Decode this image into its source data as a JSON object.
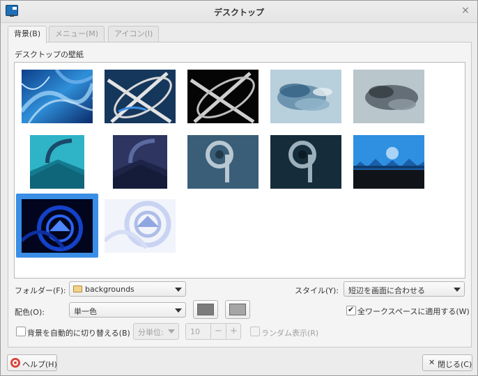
{
  "window": {
    "title": "デスクトップ",
    "close": "×"
  },
  "tabs": [
    {
      "label": "背景(B)",
      "active": true
    },
    {
      "label": "メニュー(M)",
      "active": false
    },
    {
      "label": "アイコン(I)",
      "active": false
    }
  ],
  "wallpaper_section": {
    "label": "デスクトップの壁紙",
    "selected_index": 10
  },
  "folder": {
    "label": "フォルダー(F):",
    "value": "backgrounds",
    "icon": "folder-icon"
  },
  "style": {
    "label": "スタイル(Y):",
    "value": "短辺を画面に合わせる"
  },
  "color": {
    "label": "配色(O):",
    "value": "単一色",
    "swatch1": "#7c7c7c",
    "swatch2": "#a6a6a6"
  },
  "apply_all": {
    "label": "全ワークスペースに適用する(W)",
    "checked": true
  },
  "auto_change": {
    "label": "背景を自動的に切り替える(B)",
    "checked": false,
    "unit": "分単位:",
    "interval": "10",
    "minus": "−",
    "plus": "+"
  },
  "random": {
    "label": "ランダム表示(R)",
    "checked": false
  },
  "buttons": {
    "help": "ヘルプ(H)",
    "close": "閉じる(C)"
  }
}
